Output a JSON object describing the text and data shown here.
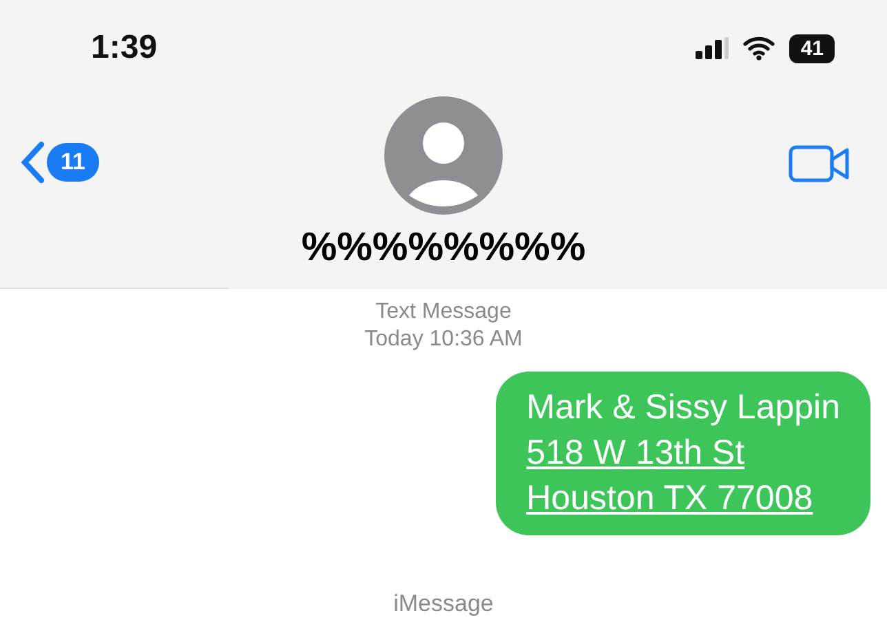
{
  "status_bar": {
    "time": "1:39",
    "battery": "41"
  },
  "nav": {
    "back_count": "11",
    "contact_name": "%%%%%%%%"
  },
  "thread_header": {
    "service": "Text Message",
    "timestamp": "Today 10:36 AM"
  },
  "messages": [
    {
      "kind": "sent",
      "lines": [
        {
          "text": "Mark & Sissy Lappin",
          "link": false
        },
        {
          "text": "518 W 13th St",
          "link": true
        },
        {
          "text": "Houston TX 77008",
          "link": true
        }
      ]
    }
  ],
  "input": {
    "placeholder": "iMessage"
  }
}
